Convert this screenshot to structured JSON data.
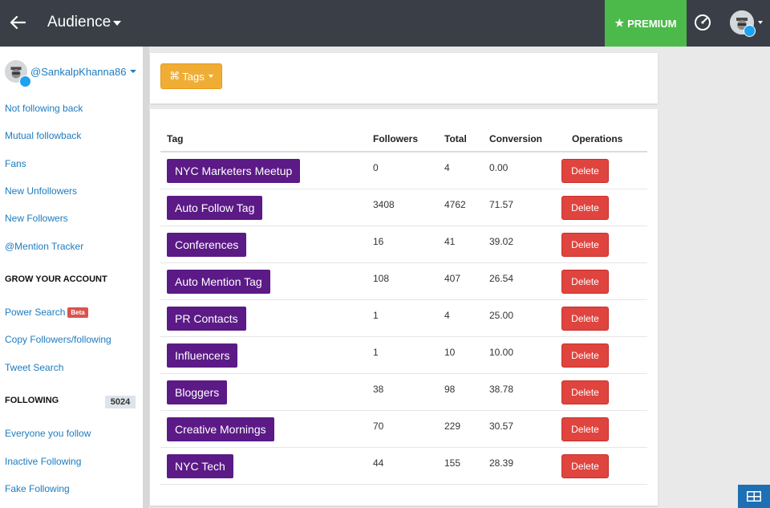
{
  "header": {
    "title": "Audience",
    "premium_label": "PREMIUM",
    "colors": {
      "bar": "#3a3f47",
      "premium": "#4cba4a"
    }
  },
  "sidebar": {
    "username": "@SankalpKhanna86",
    "links_top": [
      "Not following back",
      "Mutual followback",
      "Fans",
      "New Unfollowers",
      "New Followers",
      "@Mention Tracker"
    ],
    "grow_heading": "GROW YOUR ACCOUNT",
    "grow_links": [
      "Power Search",
      "Copy Followers/following",
      "Tweet Search"
    ],
    "beta_label": "Beta",
    "following_heading": "FOLLOWING",
    "following_count": "5024",
    "following_links": [
      "Everyone you follow",
      "Inactive Following",
      "Fake Following"
    ]
  },
  "tags_button": {
    "label": "Tags"
  },
  "table": {
    "headers": [
      "Tag",
      "Followers",
      "Total",
      "Conversion",
      "Operations"
    ],
    "delete_label": "Delete",
    "rows": [
      {
        "tag": "NYC Marketers Meetup",
        "followers": "0",
        "total": "4",
        "conversion": "0.00"
      },
      {
        "tag": "Auto Follow Tag",
        "followers": "3408",
        "total": "4762",
        "conversion": "71.57"
      },
      {
        "tag": "Conferences",
        "followers": "16",
        "total": "41",
        "conversion": "39.02"
      },
      {
        "tag": "Auto Mention Tag",
        "followers": "108",
        "total": "407",
        "conversion": "26.54"
      },
      {
        "tag": "PR Contacts",
        "followers": "1",
        "total": "4",
        "conversion": "25.00"
      },
      {
        "tag": "Influencers",
        "followers": "1",
        "total": "10",
        "conversion": "10.00"
      },
      {
        "tag": "Bloggers",
        "followers": "38",
        "total": "98",
        "conversion": "38.78"
      },
      {
        "tag": "Creative Mornings",
        "followers": "70",
        "total": "229",
        "conversion": "30.57"
      },
      {
        "tag": "NYC Tech",
        "followers": "44",
        "total": "155",
        "conversion": "28.39"
      }
    ],
    "colors": {
      "tag_chip": "#5b1a86",
      "delete": "#e0443e",
      "tags_button": "#f0ad36"
    }
  }
}
